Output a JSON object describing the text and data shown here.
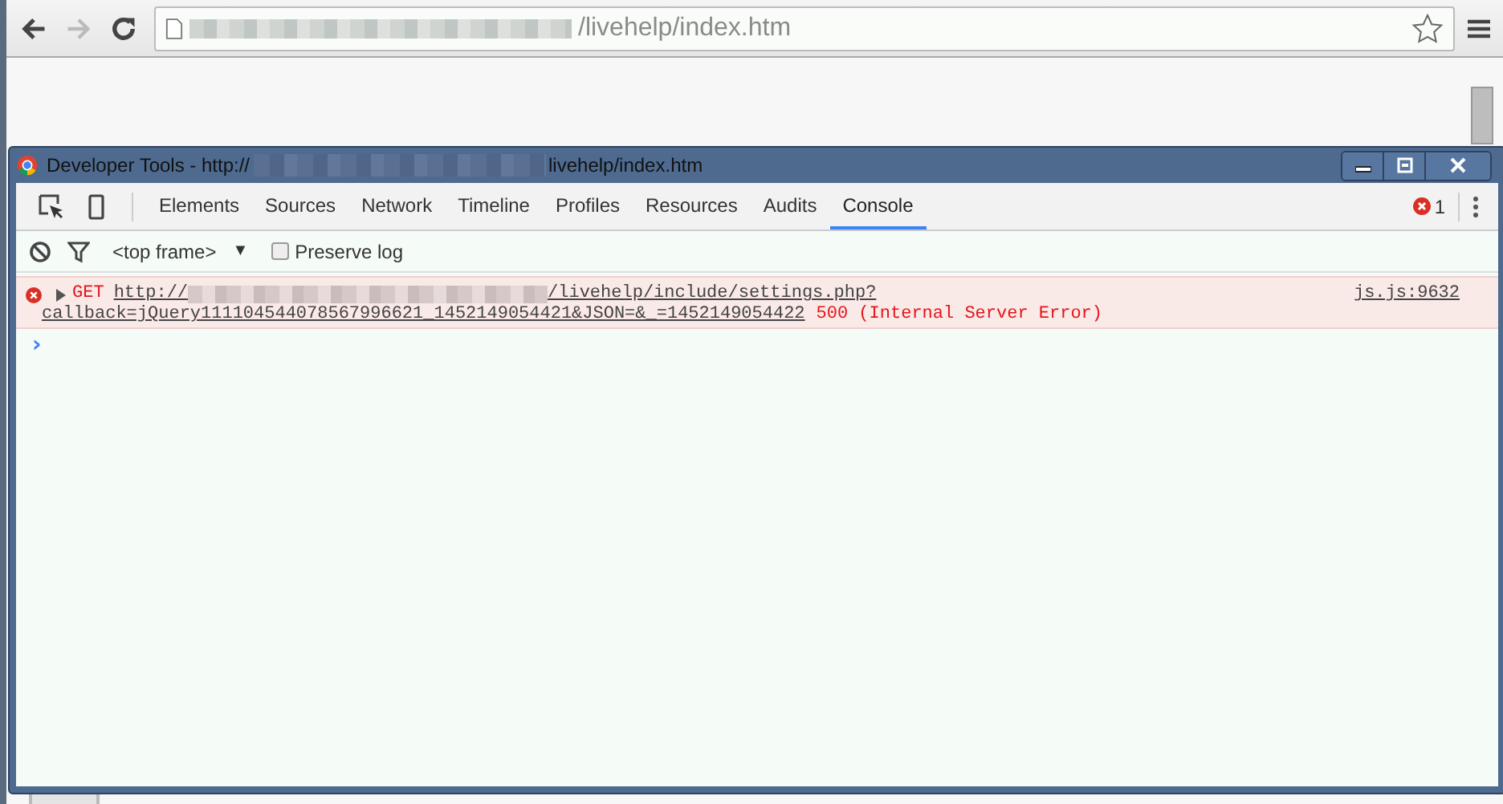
{
  "browser": {
    "address": "/livehelp/index.htm"
  },
  "devtools": {
    "title_prefix": "Developer Tools - http://",
    "title_suffix": "livehelp/index.htm",
    "tabs": [
      {
        "label": "Elements",
        "selected": false
      },
      {
        "label": "Sources",
        "selected": false
      },
      {
        "label": "Network",
        "selected": false
      },
      {
        "label": "Timeline",
        "selected": false
      },
      {
        "label": "Profiles",
        "selected": false
      },
      {
        "label": "Resources",
        "selected": false
      },
      {
        "label": "Audits",
        "selected": false
      },
      {
        "label": "Console",
        "selected": true
      }
    ],
    "error_count": "1",
    "context": "<top frame>",
    "context_caret": "▼",
    "preserve_log": {
      "label": "Preserve log",
      "checked": false
    },
    "messages": [
      {
        "kind": "error",
        "method": "GET",
        "url_prefix": "http://",
        "url_suffix": "/livehelp/include/settings.php?",
        "url_line2": "callback=jQuery111104544078567996621_1452149054421&JSON=&_=1452149054422",
        "status": "500 (Internal Server Error)",
        "source": "js.js:9632"
      }
    ],
    "prompt": "›"
  }
}
